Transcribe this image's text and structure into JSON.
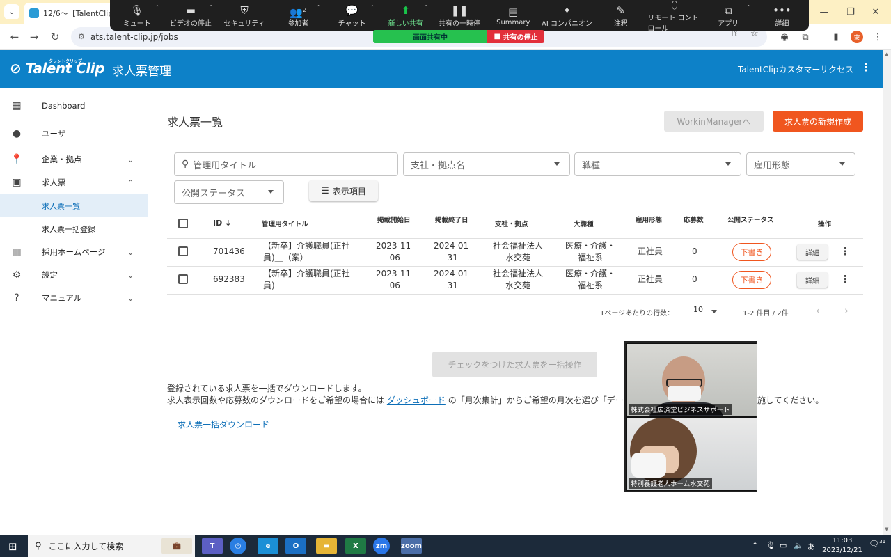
{
  "browser": {
    "tab_title": "12/6〜【TalentClip】契約",
    "url": "ats.talent-clip.jp/jobs",
    "profile_initial": "東"
  },
  "zoom": {
    "toolbar": [
      {
        "label": "ミュート",
        "icon": "mic-icon"
      },
      {
        "label": "ビデオの停止",
        "icon": "video-icon"
      },
      {
        "label": "セキュリティ",
        "icon": "shield-icon"
      },
      {
        "label": "参加者",
        "icon": "participants-icon",
        "count": "2"
      },
      {
        "label": "チャット",
        "icon": "chat-icon"
      },
      {
        "label": "新しい共有",
        "icon": "share-icon"
      },
      {
        "label": "共有の一時停",
        "icon": "pause-icon"
      },
      {
        "label": "Summary",
        "icon": "summary-icon"
      },
      {
        "label": "AI コンパニオン",
        "icon": "sparkle-icon"
      },
      {
        "label": "注釈",
        "icon": "pen-icon"
      },
      {
        "label": "リモート コントロール",
        "icon": "mouse-icon"
      },
      {
        "label": "アプリ",
        "icon": "apps-icon"
      },
      {
        "label": "詳細",
        "icon": "more-icon"
      }
    ],
    "sharing_label": "画面共有中",
    "stop_share_label": "共有の停止",
    "participants": [
      {
        "name": "株式会社広済堂ビジネスサポート"
      },
      {
        "name": "特別養護老人ホーム水交苑"
      }
    ]
  },
  "app": {
    "logo": "Talent Clip",
    "logo_sub": "タレントクリップ",
    "title": "求人票管理",
    "account": "TalentClipカスタマーサクセス"
  },
  "sidebar": {
    "items": [
      {
        "label": "Dashboard",
        "icon": "dashboard-icon"
      },
      {
        "label": "ユーザ",
        "icon": "person-icon"
      },
      {
        "label": "企業・拠点",
        "icon": "location-icon"
      },
      {
        "label": "求人票",
        "icon": "badge-icon"
      },
      {
        "label": "採用ホームページ",
        "icon": "web-icon"
      },
      {
        "label": "設定",
        "icon": "gear-icon"
      },
      {
        "label": "マニュアル",
        "icon": "help-icon"
      }
    ],
    "sub_items": [
      {
        "label": "求人票一覧",
        "active": true
      },
      {
        "label": "求人票一括登録",
        "active": false
      }
    ]
  },
  "main": {
    "title": "求人票一覧",
    "workin_button": "WorkinManagerへ",
    "new_button": "求人票の新規作成",
    "filters": {
      "search_placeholder": "管理用タイトル",
      "branch_placeholder": "支社・拠点名",
      "job_type_placeholder": "職種",
      "employment_placeholder": "雇用形態",
      "status_placeholder": "公開ステータス",
      "columns_button": "表示項目"
    },
    "table": {
      "headers": {
        "id": "ID",
        "title": "管理用タイトル",
        "start": "掲載開始日",
        "end": "掲載終了日",
        "branch": "支社・拠点",
        "category": "大職種",
        "employment": "雇用形態",
        "applicants": "応募数",
        "status": "公開ステータス",
        "actions": "操作"
      },
      "rows": [
        {
          "id": "701436",
          "title_1": "【新卒】介護職員(正社",
          "title_2": "員)＿（案）",
          "start_1": "2023-11-",
          "start_2": "06",
          "end_1": "2024-01-",
          "end_2": "31",
          "branch_1": "社会福祉法人",
          "branch_2": "水交苑",
          "category_1": "医療・介護・",
          "category_2": "福祉系",
          "employment": "正社員",
          "applicants": "0",
          "status": "下書き",
          "detail": "詳細"
        },
        {
          "id": "692383",
          "title_1": "【新卒】介護職員(正社",
          "title_2": "員)",
          "start_1": "2023-11-",
          "start_2": "06",
          "end_1": "2024-01-",
          "end_2": "31",
          "branch_1": "社会福祉法人",
          "branch_2": "水交苑",
          "category_1": "医療・介護・",
          "category_2": "福祉系",
          "employment": "正社員",
          "applicants": "0",
          "status": "下書き",
          "detail": "詳細"
        }
      ]
    },
    "pagination": {
      "rows_label": "1ページあたりの行数：",
      "rows_value": "10",
      "range": "1-2 件目 / 2件"
    },
    "bulk_button": "チェックをつけた求人票を一括操作",
    "info_line1": "登録されている求人票を一括でダウンロードします。",
    "info_line2_pre": "求人表示回数や応募数のダウンロードをご希望の場合には",
    "info_link": "ダッシュボード",
    "info_line2_post": "の「月次集計」からご希望の月次を選び「データ",
    "info_line2_tail": "施してください。",
    "download_link": "求人票一括ダウンロード"
  },
  "taskbar": {
    "search_placeholder": "ここに入力して検索",
    "time": "11:03",
    "date": "2023/12/21",
    "notif_count": "31"
  }
}
